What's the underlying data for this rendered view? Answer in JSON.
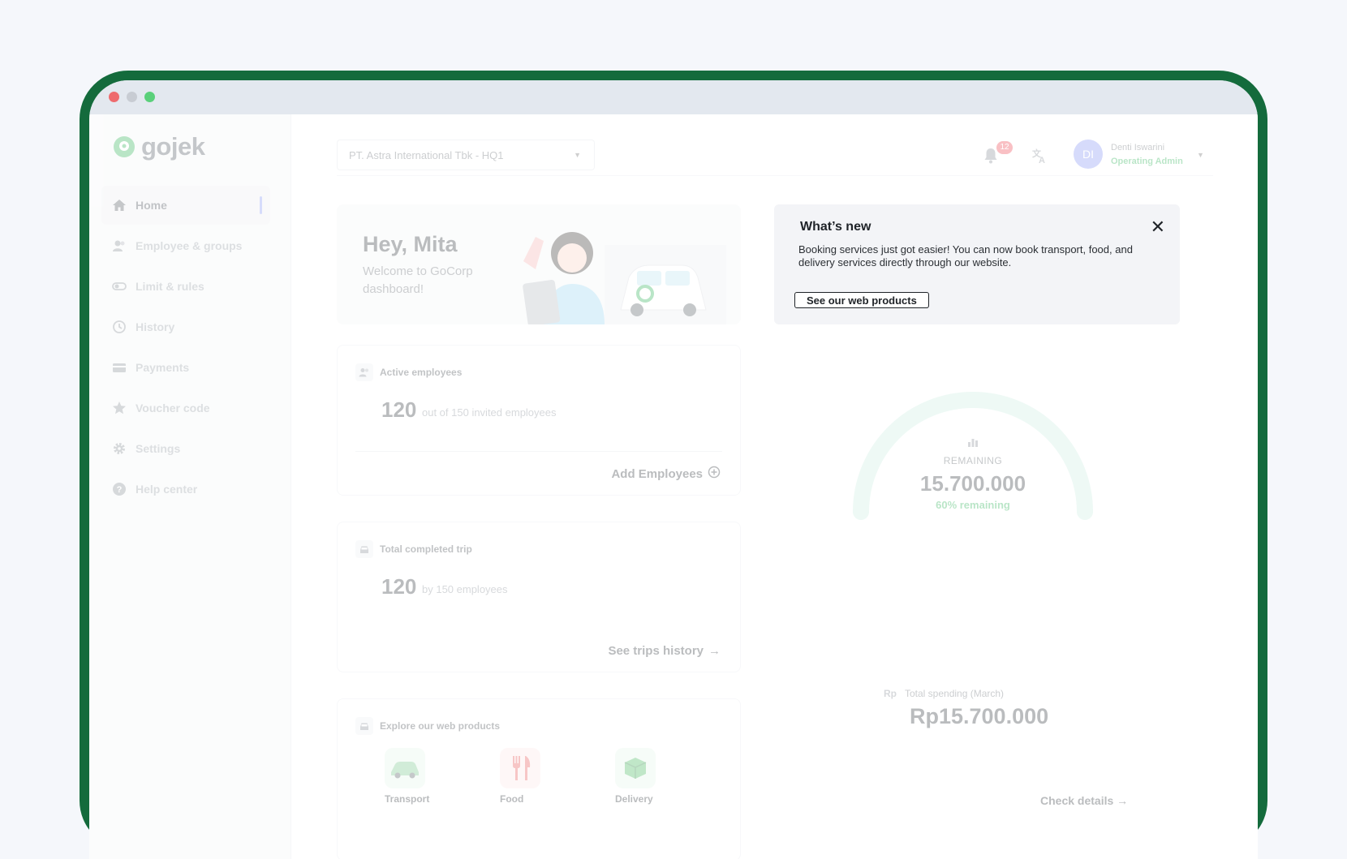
{
  "window": {
    "controls": [
      "close",
      "minimize",
      "maximize"
    ]
  },
  "brand": {
    "name": "gojek",
    "color": "#38b65f"
  },
  "sidebar": {
    "items": [
      {
        "label": "Home",
        "icon": "home-icon",
        "active": true
      },
      {
        "label": "Employee & groups",
        "icon": "users-icon"
      },
      {
        "label": "Limit & rules",
        "icon": "toggle-icon"
      },
      {
        "label": "History",
        "icon": "history-icon"
      },
      {
        "label": "Payments",
        "icon": "card-icon"
      },
      {
        "label": "Voucher code",
        "icon": "star-icon"
      },
      {
        "label": "Settings",
        "icon": "gear-icon"
      },
      {
        "label": "Help center",
        "icon": "help-icon"
      }
    ]
  },
  "topbar": {
    "company": "PT. Astra International Tbk - HQ1",
    "notifications_count": "12",
    "user": {
      "initials": "DI",
      "name": "Denti Iswarini",
      "role": "Operating Admin"
    }
  },
  "hello": {
    "title": "Hey, Mita",
    "subtitle": "Welcome to GoCorp dashboard!"
  },
  "active_employees": {
    "label": "Active employees",
    "count": "120",
    "sub": "out of 150 invited employees",
    "link": "Add Employees"
  },
  "trips": {
    "label": "Total completed trip",
    "count": "120",
    "sub": "by 150 employees",
    "link": "See trips history"
  },
  "explore": {
    "label": "Explore our web products",
    "products": [
      {
        "label": "Transport",
        "color": "#e6f6ea"
      },
      {
        "label": "Food",
        "color": "#fde8e8"
      },
      {
        "label": "Delivery",
        "color": "#e6f6ea"
      }
    ]
  },
  "budget": {
    "remaining_label": "REMAINING",
    "remaining_value": "15.700.000",
    "remaining_pct": "60% remaining",
    "remaining_fraction": 0.6,
    "spend_label": "Total spending (March)",
    "spend_prefix": "Rp",
    "spend_value": "Rp15.700.000",
    "check_details": "Check details"
  },
  "whats_new": {
    "title": "What’s new",
    "body": "Booking services just got easier! You can now book transport, food, and delivery services directly through our website.",
    "button": "See our web products"
  }
}
